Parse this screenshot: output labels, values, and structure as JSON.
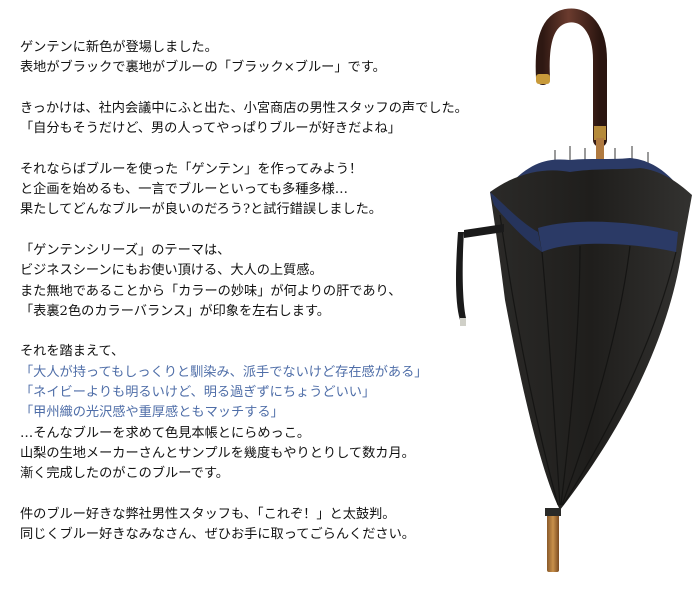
{
  "colors": {
    "text": "#111111",
    "accent_blue": "#4f6ea8",
    "canopy_black": "#222220",
    "lining_navy": "#2b3a66",
    "handle_brown": "#4a2a22"
  },
  "paragraphs": [
    {
      "lines": [
        "ゲンテンに新色が登場しました。",
        "表地がブラックで裏地がブルーの「ブラック×ブルー」です。"
      ]
    },
    {
      "lines": [
        "きっかけは、社内会議中にふと出た、小宮商店の男性スタッフの声でした。",
        "「自分もそうだけど、男の人ってやっぱりブルーが好きだよね」"
      ]
    },
    {
      "lines": [
        "それならばブルーを使った「ゲンテン」を作ってみよう！",
        "と企画を始めるも、一言でブルーといっても多種多様…",
        "果たしてどんなブルーが良いのだろう?と試行錯誤しました。"
      ]
    },
    {
      "lines": [
        "「ゲンテンシリーズ」のテーマは、",
        "ビジネスシーンにもお使い頂ける、大人の上質感。",
        "また無地であることから「カラーの妙味」が何よりの肝であり、",
        "「表裏2色のカラーバランス」が印象を左右します。"
      ]
    },
    {
      "lines": [
        "それを踏まえて、"
      ],
      "accent_lines": [
        "「大人が持ってもしっくりと馴染み、派手でないけど存在感がある」",
        "「ネイビーよりも明るいけど、明る過ぎずにちょうどいい」",
        "「甲州織の光沢感や重厚感ともマッチする」"
      ],
      "trailing_lines": [
        "…そんなブルーを求めて色見本帳とにらめっこ。",
        "山梨の生地メーカーさんとサンプルを幾度もやりとりして数カ月。",
        "漸く完成したのがこのブルーです。"
      ]
    },
    {
      "lines": [
        "件のブルー好きな弊社男性スタッフも、「これぞ！」と太鼓判。",
        "同じくブルー好きなみなさん、ぜひお手に取ってごらんください。"
      ]
    }
  ],
  "image": {
    "icon": "closed-umbrella-icon",
    "description_colors": [
      "black canopy",
      "navy blue lining",
      "brown wooden crook handle"
    ]
  }
}
